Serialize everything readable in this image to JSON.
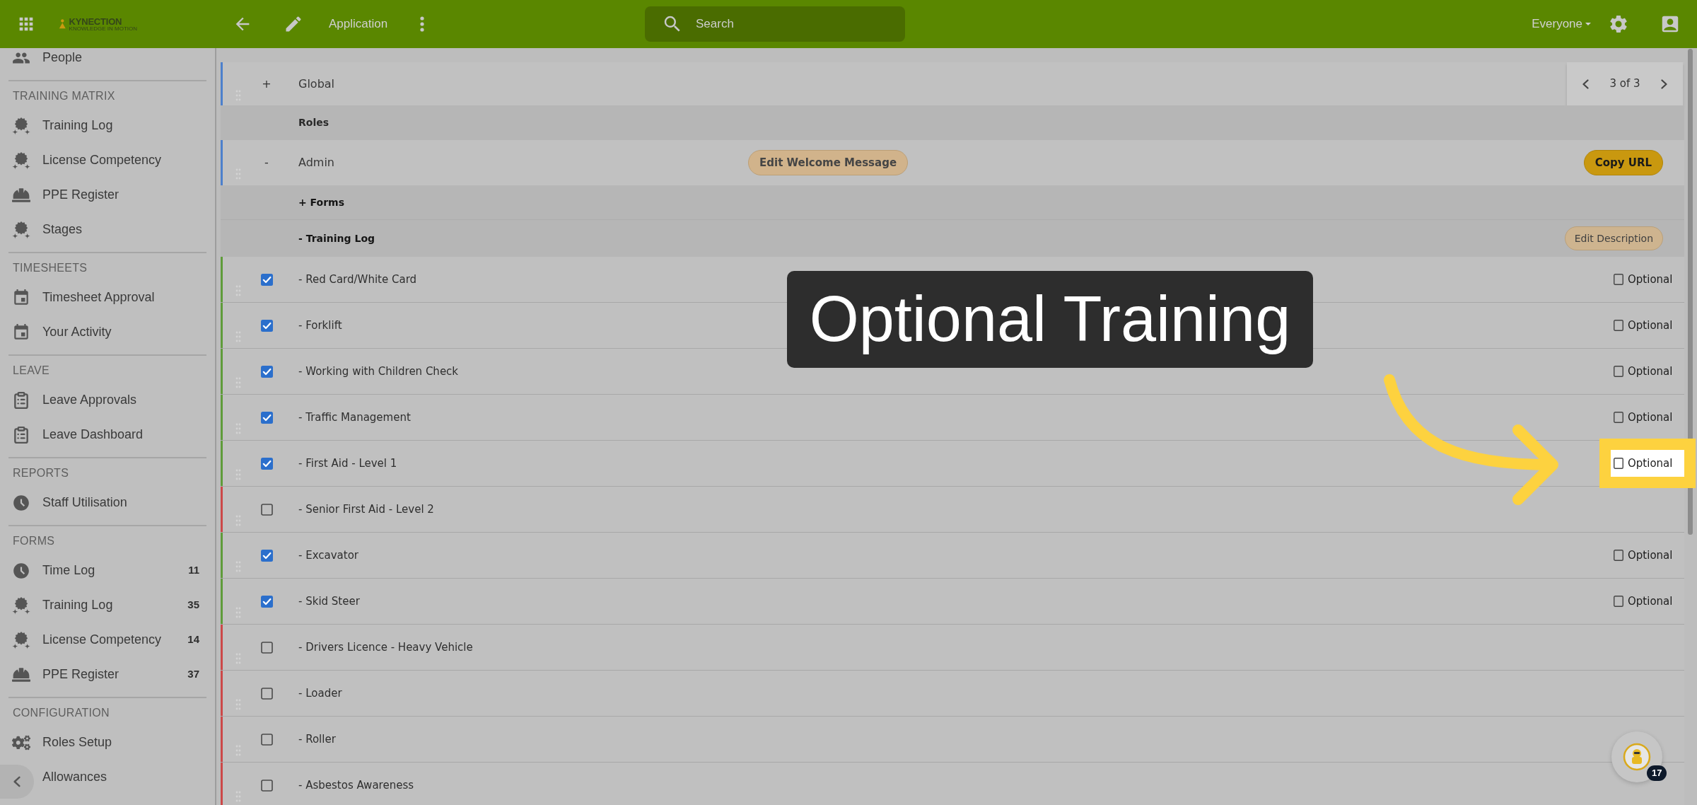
{
  "top_bar": {
    "logo": {
      "wordmark": "KYNECTION",
      "tagline": "KNOWLEDGE IN MOTION"
    },
    "title": "Application",
    "search": {
      "placeholder": "Search"
    },
    "audience": "Everyone"
  },
  "sidebar": {
    "sections": [
      {
        "items": [
          {
            "kind": "people",
            "label": "People"
          }
        ]
      },
      {
        "title": "TRAINING MATRIX",
        "items": [
          {
            "kind": "training",
            "label": "Training Log"
          },
          {
            "kind": "training",
            "label": "License Competency"
          },
          {
            "kind": "ppe",
            "label": "PPE Register"
          },
          {
            "kind": "training",
            "label": "Stages"
          }
        ]
      },
      {
        "title": "TIMESHEETS",
        "items": [
          {
            "kind": "calendar",
            "label": "Timesheet Approval"
          },
          {
            "kind": "calendar",
            "label": "Your Activity"
          }
        ]
      },
      {
        "title": "LEAVE",
        "items": [
          {
            "kind": "leave",
            "label": "Leave Approvals"
          },
          {
            "kind": "leave",
            "label": "Leave Dashboard"
          }
        ]
      },
      {
        "title": "REPORTS",
        "items": [
          {
            "kind": "time",
            "label": "Staff Utilisation"
          }
        ]
      },
      {
        "title": "FORMS",
        "items": [
          {
            "kind": "time",
            "label": "Time Log",
            "count": "11"
          },
          {
            "kind": "training",
            "label": "Training Log",
            "count": "35"
          },
          {
            "kind": "training",
            "label": "License Competency",
            "count": "14"
          },
          {
            "kind": "ppe",
            "label": "PPE Register",
            "count": "37"
          }
        ]
      },
      {
        "title": "CONFIGURATION",
        "items": [
          {
            "kind": "setup",
            "label": "Roles Setup"
          },
          {
            "kind": "plain",
            "label": "Allowances"
          }
        ]
      }
    ]
  },
  "main": {
    "global_row": {
      "toggle": "+",
      "label": "Global",
      "pager": "3 of 3"
    },
    "roles_row": {
      "label": "Roles"
    },
    "admin_row": {
      "toggle": "-",
      "label": "Admin",
      "buttons": [
        {
          "kind": "secondary",
          "label": "Edit Welcome Message"
        },
        {
          "kind": "primary",
          "label": "Copy URL"
        }
      ]
    },
    "forms_row": {
      "label": "+ Forms"
    },
    "training_row": {
      "label": "- Training Log",
      "button": "Edit Description"
    },
    "trainings": [
      {
        "label": "- Red Card/White Card",
        "checked": true,
        "color": "#5f9c3a",
        "optional": {
          "label": "Optional",
          "checked": false,
          "highlighted": false
        }
      },
      {
        "label": "- Forklift",
        "checked": true,
        "color": "#5f9c3a",
        "optional": {
          "label": "Optional",
          "checked": false,
          "highlighted": false
        }
      },
      {
        "label": "- Working with Children Check",
        "checked": true,
        "color": "#5f9c3a",
        "optional": {
          "label": "Optional",
          "checked": false,
          "highlighted": false
        }
      },
      {
        "label": "- Traffic Management",
        "checked": true,
        "color": "#5f9c3a",
        "optional": {
          "label": "Optional",
          "checked": false,
          "highlighted": false
        }
      },
      {
        "label": "- First Aid - Level 1",
        "checked": true,
        "color": "#5f9c3a",
        "optional": {
          "label": "Optional",
          "checked": false,
          "highlighted": true
        }
      },
      {
        "label": "- Senior First Aid - Level 2",
        "checked": false,
        "color": "#cc4848"
      },
      {
        "label": "- Excavator",
        "checked": true,
        "color": "#5f9c3a",
        "optional": {
          "label": "Optional",
          "checked": false,
          "highlighted": false
        }
      },
      {
        "label": "- Skid Steer",
        "checked": true,
        "color": "#5f9c3a",
        "optional": {
          "label": "Optional",
          "checked": false,
          "highlighted": false
        }
      },
      {
        "label": "- Drivers Licence - Heavy Vehicle",
        "checked": false,
        "color": "#cc4848"
      },
      {
        "label": "- Loader",
        "checked": false,
        "color": "#cc4848"
      },
      {
        "label": "- Roller",
        "checked": false,
        "color": "#cc4848"
      },
      {
        "label": "- Asbestos Awareness",
        "checked": false,
        "color": "#cc4848"
      }
    ]
  },
  "callout": {
    "text": "Optional Training"
  },
  "floating_button": {
    "badge": "17"
  }
}
